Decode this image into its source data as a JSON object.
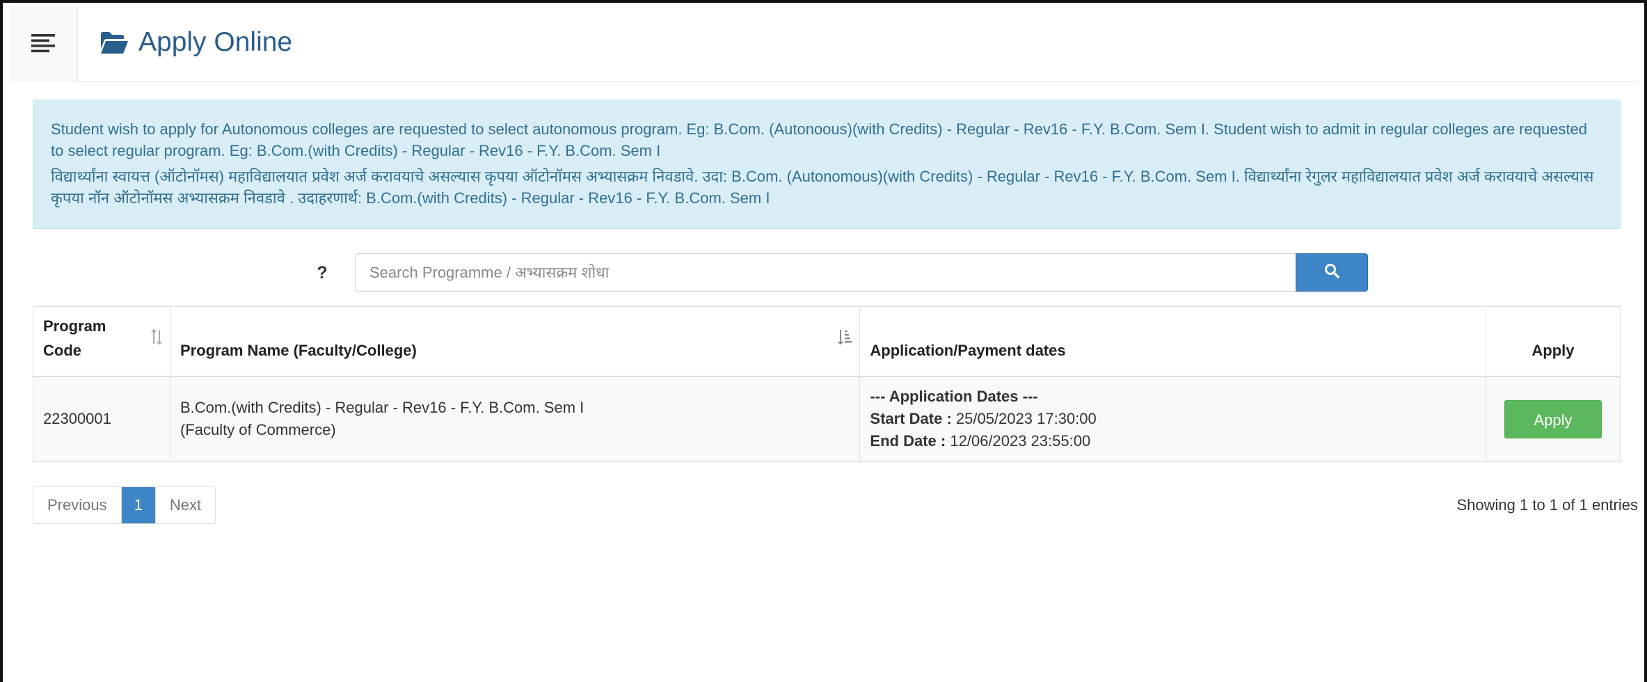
{
  "header": {
    "menu_icon": "hamburger-icon",
    "title_icon": "folder-open-icon",
    "title": "Apply Online"
  },
  "notice": {
    "english": "Student wish to apply for Autonomous colleges are requested to select autonomous program. Eg: B.Com. (Autonoous)(with Credits) - Regular - Rev16 - F.Y. B.Com. Sem I. Student wish to admit in regular colleges are requested to select regular program. Eg: B.Com.(with Credits) - Regular - Rev16 - F.Y. B.Com. Sem I",
    "marathi": "विद्यार्थ्यांना स्वायत्त (ऑटोनॉमस) महाविद्यालयात प्रवेश अर्ज करावयाचे असल्यास कृपया ऑटोनॉमस अभ्यासक्रम निवडावे. उदा: B.Com. (Autonomous)(with Credits) - Regular - Rev16 - F.Y. B.Com. Sem I. विद्यार्थ्यांना रेगुलर महाविद्यालयात प्रवेश अर्ज करावयाचे असल्यास कृपया नॉन ऑटोनॉमस अभ्यासक्रम निवडावे . उदाहरणार्थ: B.Com.(with Credits) - Regular - Rev16 - F.Y. B.Com. Sem I"
  },
  "search": {
    "help": "?",
    "placeholder": "Search Programme / अभ्यासक्रम शोधा",
    "button_icon": "search-icon"
  },
  "table": {
    "columns": {
      "code": "Program Code",
      "name": "Program Name (Faculty/College)",
      "dates": "Application/Payment dates",
      "apply": "Apply"
    },
    "rows": [
      {
        "code": "22300001",
        "name": "B.Com.(with Credits) - Regular - Rev16 - F.Y. B.Com. Sem I",
        "faculty": "(Faculty of Commerce)",
        "dates_heading": "--- Application Dates ---",
        "start_label": "Start Date :",
        "start_value": " 25/05/2023 17:30:00",
        "end_label": "End Date :",
        "end_value": " 12/06/2023 23:55:00",
        "apply_label": "Apply"
      }
    ]
  },
  "pagination": {
    "previous": "Previous",
    "current": "1",
    "next": "Next",
    "info": "Showing 1 to 1 of 1 entries"
  },
  "colors": {
    "title": "#2a5e8d",
    "alert_bg": "#d9edf7",
    "alert_text": "#31708f",
    "primary": "#3d85c6",
    "success": "#5cb85c"
  }
}
